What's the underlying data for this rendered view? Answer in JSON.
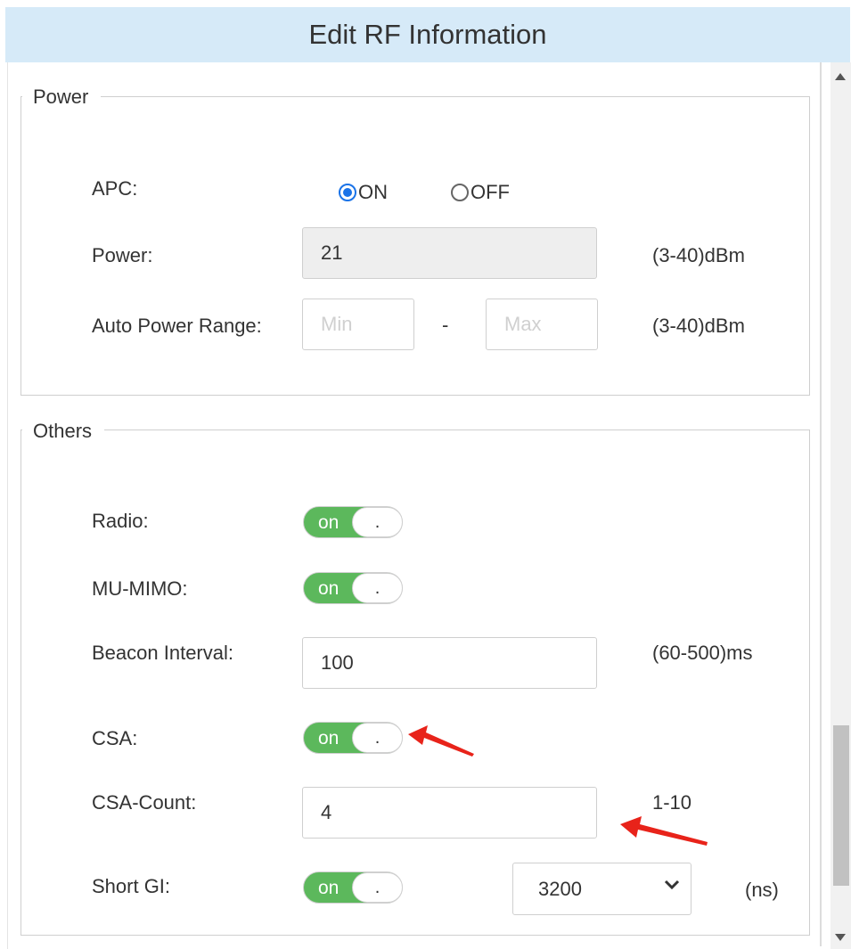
{
  "dialog": {
    "title": "Edit RF Information"
  },
  "power": {
    "legend": "Power",
    "apc_label": "APC:",
    "apc_on": "ON",
    "apc_off": "OFF",
    "apc_selected": "ON",
    "power_label": "Power:",
    "power_value": "21",
    "power_unit": "(3-40)dBm",
    "auto_range_label": "Auto Power Range:",
    "min_placeholder": "Min",
    "range_separator": "-",
    "max_placeholder": "Max",
    "auto_range_unit": "(3-40)dBm"
  },
  "others": {
    "legend": "Others",
    "radio_label": "Radio:",
    "radio_state": "on",
    "mumimo_label": "MU-MIMO:",
    "mumimo_state": "on",
    "beacon_label": "Beacon Interval:",
    "beacon_value": "100",
    "beacon_unit": "(60-500)ms",
    "csa_label": "CSA:",
    "csa_state": "on",
    "csa_count_label": "CSA-Count:",
    "csa_count_value": "4",
    "csa_count_unit": "1-10",
    "short_gi_label": "Short GI:",
    "short_gi_state": "on",
    "short_gi_select": "3200",
    "short_gi_unit": "(ns)",
    "toggle_knob": "."
  },
  "colors": {
    "title_bar": "#d6eaf8",
    "toggle_on": "#5cb85c",
    "radio_selected": "#1a73e8",
    "annotation_arrow": "#e8231a"
  }
}
